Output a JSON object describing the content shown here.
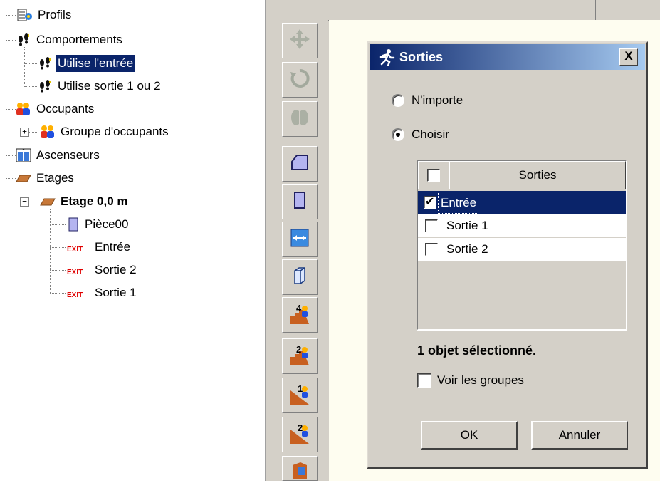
{
  "tree": {
    "items": [
      {
        "label": "Profils",
        "icon": "profiles-icon"
      },
      {
        "label": "Comportements",
        "icon": "footprints-icon"
      },
      {
        "label": "Utilise l'entrée",
        "icon": "footprints-icon",
        "selected": true
      },
      {
        "label": "Utilise sortie 1 ou 2",
        "icon": "footprints-icon"
      },
      {
        "label": "Occupants",
        "icon": "occupants-icon"
      },
      {
        "label": "Groupe d'occupants",
        "icon": "occupants-icon",
        "expander": "+"
      },
      {
        "label": "Ascenseurs",
        "icon": "elevator-icon"
      },
      {
        "label": "Etages",
        "icon": "floor-icon"
      },
      {
        "label": "Etage 0,0 m",
        "icon": "floor-icon",
        "expander": "−",
        "bold": true
      },
      {
        "label": "Pièce00",
        "icon": "room-icon"
      },
      {
        "label": "Entrée",
        "icon": "exit-icon",
        "icon_text": "EXIT"
      },
      {
        "label": "Sortie 2",
        "icon": "exit-icon",
        "icon_text": "EXIT"
      },
      {
        "label": "Sortie 1",
        "icon": "exit-icon",
        "icon_text": "EXIT"
      }
    ]
  },
  "toolbar": {
    "buttons": [
      {
        "name": "move-tool-button",
        "icon": "move-arrows-icon",
        "disabled": true
      },
      {
        "name": "rotate-tool-button",
        "icon": "rotate-icon",
        "disabled": true
      },
      {
        "name": "mirror-tool-button",
        "icon": "mirror-icon",
        "disabled": true
      },
      {
        "name": "draw-polygon-room-button",
        "icon": "polygon-room-icon"
      },
      {
        "name": "draw-rectangle-room-button",
        "icon": "rectangle-room-icon"
      },
      {
        "name": "draw-door-button",
        "icon": "door-icon"
      },
      {
        "name": "draw-3d-object-button",
        "icon": "box-3d-icon"
      },
      {
        "name": "stairs-up-4-button",
        "icon": "stairs-icon",
        "icon_text": "4"
      },
      {
        "name": "stairs-up-2-button",
        "icon": "stairs-icon",
        "icon_text": "2"
      },
      {
        "name": "ramp-1-button",
        "icon": "ramp-icon",
        "icon_text": "1"
      },
      {
        "name": "ramp-2-button",
        "icon": "ramp-icon",
        "icon_text": "2"
      },
      {
        "name": "elevator-tool-button",
        "icon": "elevator-tool-icon"
      }
    ]
  },
  "dialog": {
    "title": "Sorties",
    "close_label": "X",
    "radio_any": "N'importe",
    "radio_choose": "Choisir",
    "selected_radio": "Choisir",
    "list_header": "Sorties",
    "rows": [
      {
        "label": "Entrée",
        "checked": true,
        "selected": true
      },
      {
        "label": "Sortie 1",
        "checked": false,
        "selected": false
      },
      {
        "label": "Sortie 2",
        "checked": false,
        "selected": false
      }
    ],
    "status": "1 objet sélectionné.",
    "show_groups_label": "Voir les groupes",
    "ok_label": "OK",
    "cancel_label": "Annuler"
  },
  "colors": {
    "selection": "#0a246a",
    "face": "#d4d0c8",
    "canvas": "#fefdf0"
  }
}
